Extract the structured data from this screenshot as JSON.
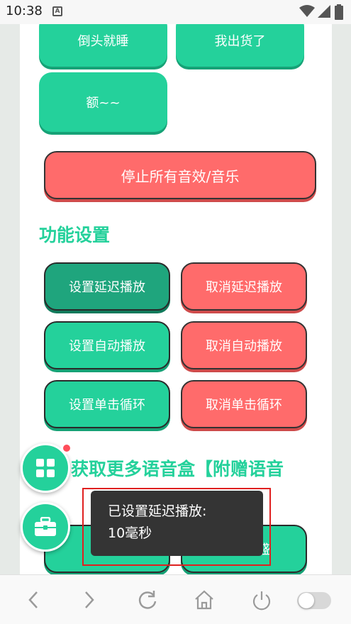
{
  "status_bar": {
    "time": "10:38",
    "notification_icon": "A"
  },
  "top_buttons": [
    "倒头就睡",
    "我出货了",
    "额~~"
  ],
  "stop_all_label": "停止所有音效/音乐",
  "settings": {
    "title": "功能设置",
    "set_delay": "设置延迟播放",
    "cancel_delay": "取消延迟播放",
    "set_auto": "设置自动播放",
    "cancel_auto": "取消自动播放",
    "set_loop": "设置单击循环",
    "cancel_loop": "取消单击循环"
  },
  "more_title": "获取更多语音盒【附赠语音",
  "partial_button_text": "盛",
  "toast": {
    "line1": "已设置延迟播放:",
    "line2": "10毫秒"
  },
  "fab_icons": [
    "grid-icon",
    "toolbox-icon"
  ],
  "nav_icons": [
    "back-icon",
    "forward-icon",
    "refresh-icon",
    "home-icon",
    "power-icon",
    "toggle-switch"
  ],
  "colors": {
    "primary_green": "#24d19b",
    "pressed_green": "#1fa57d",
    "red": "#ff6b6b",
    "badge": "#ff4d5a",
    "toast_bg": "#343434",
    "highlight_border": "#e02020"
  }
}
